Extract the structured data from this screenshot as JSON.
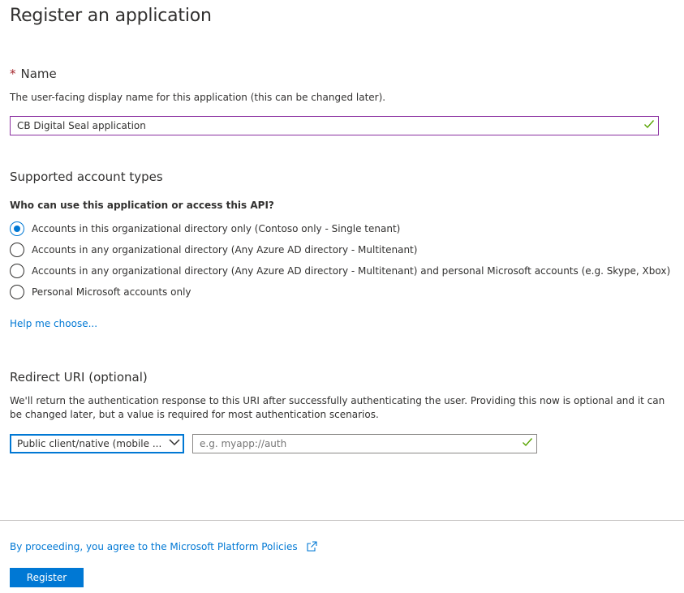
{
  "page": {
    "title": "Register an application"
  },
  "name_section": {
    "required_marker": "*",
    "label": "Name",
    "description": "The user-facing display name for this application (this can be changed later).",
    "value": "CB Digital Seal application"
  },
  "account_types": {
    "heading": "Supported account types",
    "question": "Who can use this application or access this API?",
    "options": [
      {
        "label": "Accounts in this organizational directory only (Contoso only - Single tenant)",
        "selected": true
      },
      {
        "label": "Accounts in any organizational directory (Any Azure AD directory - Multitenant)",
        "selected": false
      },
      {
        "label": "Accounts in any organizational directory (Any Azure AD directory - Multitenant) and personal Microsoft accounts (e.g. Skype, Xbox)",
        "selected": false
      },
      {
        "label": "Personal Microsoft accounts only",
        "selected": false
      }
    ],
    "help_link": "Help me choose..."
  },
  "redirect": {
    "heading": "Redirect URI (optional)",
    "description": "We'll return the authentication response to this URI after successfully authenticating the user. Providing this now is optional and it can be changed later, but a value is required for most authentication scenarios.",
    "platform_selected": "Public client/native (mobile ...",
    "uri_placeholder": "e.g. myapp://auth"
  },
  "footer": {
    "policy_link": "By proceeding, you agree to the Microsoft Platform Policies",
    "register_label": "Register"
  },
  "colors": {
    "accent": "#0078d4",
    "focus_border": "#8a2fa0",
    "valid_check": "#57a300"
  }
}
